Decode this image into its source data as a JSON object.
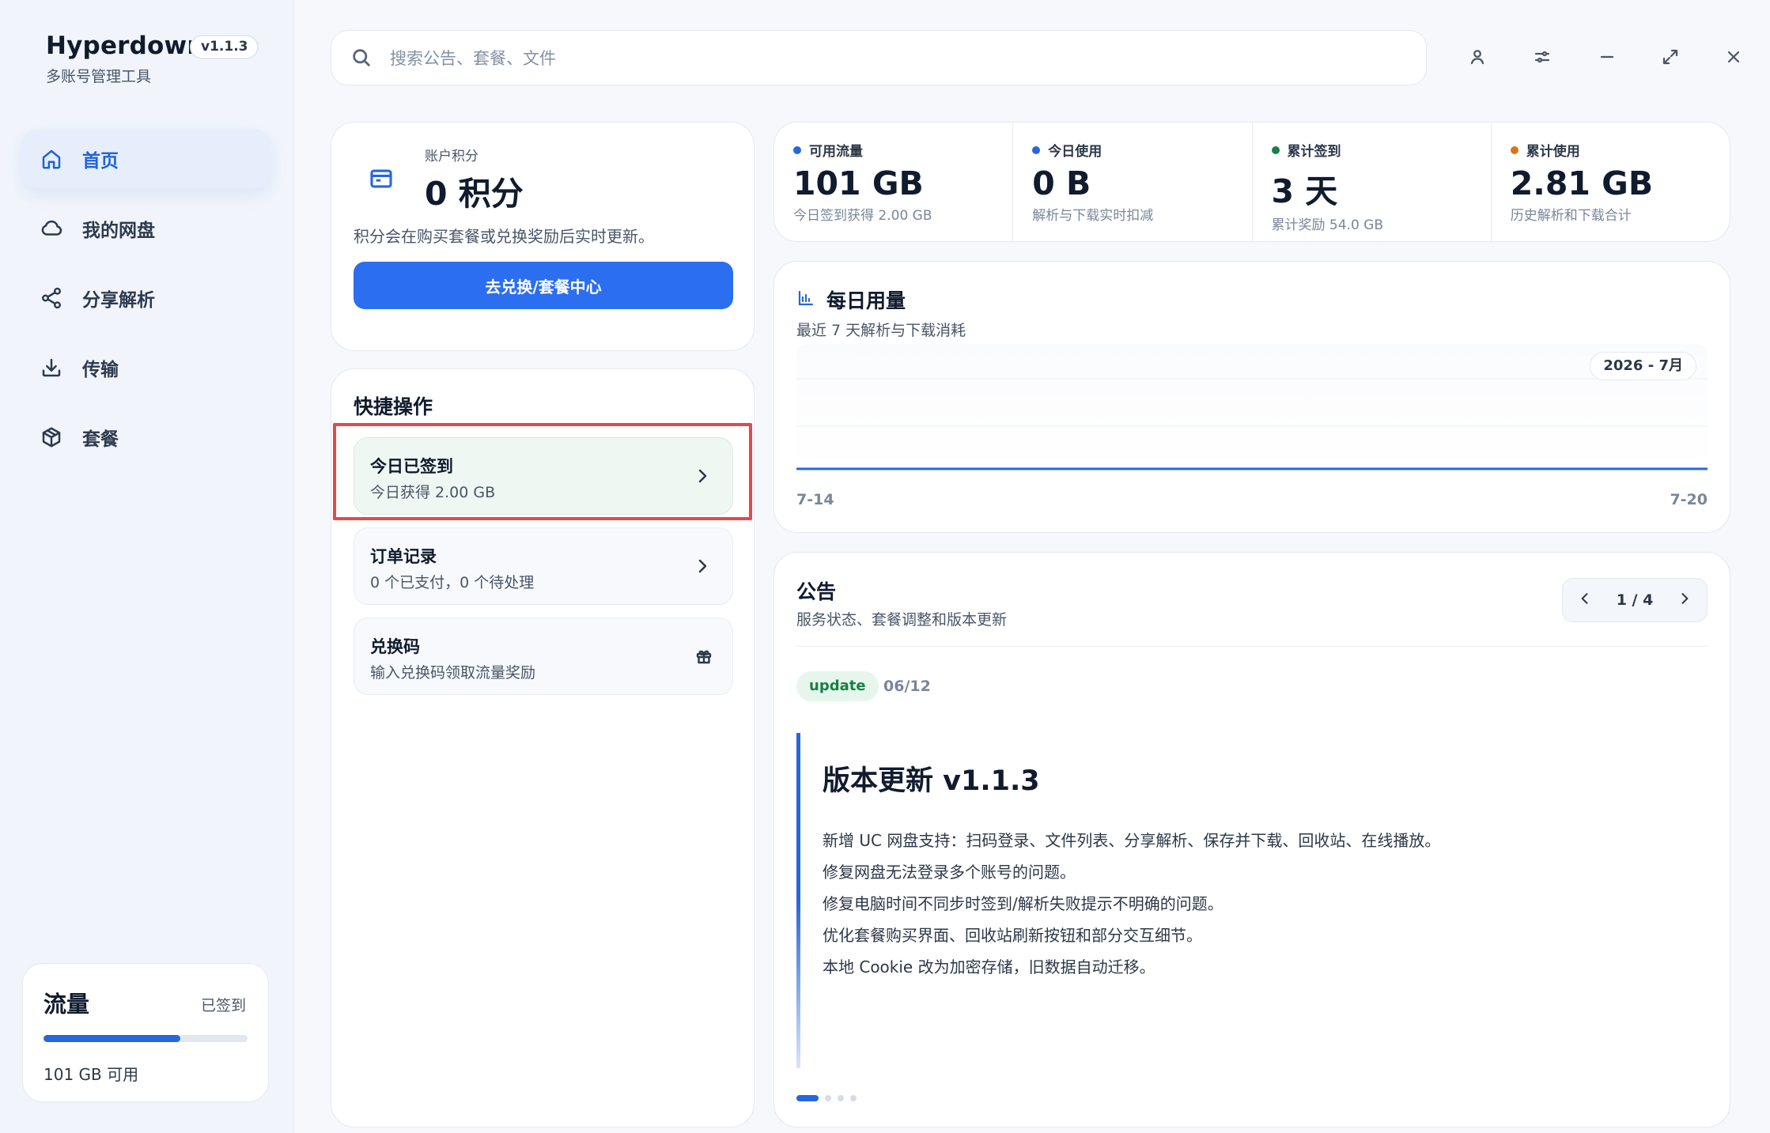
{
  "brand": {
    "name": "Hyperdown",
    "version": "v1.1.3",
    "subtitle": "多账号管理工具"
  },
  "sidebar": {
    "items": [
      {
        "label": "首页",
        "icon": "home-icon",
        "active": true
      },
      {
        "label": "我的网盘",
        "icon": "cloud-icon",
        "active": false
      },
      {
        "label": "分享解析",
        "icon": "share-icon",
        "active": false
      },
      {
        "label": "传输",
        "icon": "download-icon",
        "active": false
      },
      {
        "label": "套餐",
        "icon": "package-icon",
        "active": false
      }
    ]
  },
  "traffic": {
    "title": "流量",
    "status": "已签到",
    "available": "101 GB 可用",
    "fill_fraction": 0.67
  },
  "search": {
    "placeholder": "搜索公告、套餐、文件"
  },
  "window_buttons": [
    "user-icon",
    "settings-sliders-icon",
    "minimize-icon",
    "expand-icon",
    "close-icon"
  ],
  "points": {
    "label": "账户积分",
    "value": "0 积分",
    "desc": "积分会在购买套餐或兑换奖励后实时更新。",
    "button": "去兑换/套餐中心"
  },
  "quick": {
    "title": "快捷操作",
    "items": [
      {
        "title": "今日已签到",
        "sub": "今日获得 2.00 GB"
      },
      {
        "title": "订单记录",
        "sub": "0 个已支付，0 个待处理"
      },
      {
        "title": "兑换码",
        "sub": "输入兑换码领取流量奖励"
      }
    ]
  },
  "stats": [
    {
      "label": "可用流量",
      "value": "101 GB",
      "sub": "今日签到获得 2.00 GB",
      "color": "#2667e0"
    },
    {
      "label": "今日使用",
      "value": "0 B",
      "sub": "解析与下载实时扣减",
      "color": "#2667e0"
    },
    {
      "label": "累计签到",
      "value": "3 天",
      "sub": "累计奖励 54.0 GB",
      "color": "#178046"
    },
    {
      "label": "累计使用",
      "value": "2.81 GB",
      "sub": "历史解析和下载合计",
      "color": "#d9731c"
    }
  ],
  "chart": {
    "title": "每日用量",
    "subtitle": "最近 7 天解析与下载消耗",
    "month": "2026 - 7月",
    "x_start": "7-14",
    "x_end": "7-20"
  },
  "chart_data": {
    "type": "line",
    "x": [
      "7-14",
      "7-20"
    ],
    "values": [
      0,
      0
    ],
    "title": "每日用量",
    "color": "#2667e0"
  },
  "notice": {
    "title": "公告",
    "subtitle": "服务状态、套餐调整和版本更新",
    "pager": "1 / 4",
    "tag": "update",
    "date": "06/12",
    "article_title": "版本更新 v1.1.3",
    "lines": [
      "新增 UC 网盘支持：扫码登录、文件列表、分享解析、保存并下载、回收站、在线播放。",
      "修复网盘无法登录多个账号的问题。",
      "修复电脑时间不同步时签到/解析失败提示不明确的问题。",
      "优化套餐购买界面、回收站刷新按钮和部分交互细节。",
      "本地 Cookie 改为加密存储，旧数据自动迁移。"
    ],
    "page_count": 4,
    "current_page": 1
  }
}
